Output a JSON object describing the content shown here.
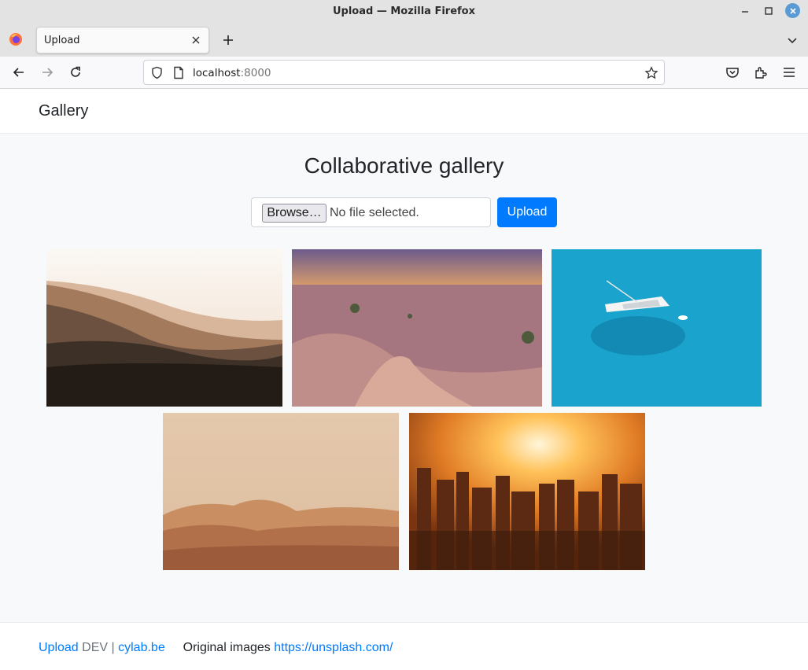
{
  "window": {
    "title": "Upload — Mozilla Firefox"
  },
  "browser": {
    "tab_label": "Upload",
    "url_host": "localhost",
    "url_port": ":8000"
  },
  "navbar": {
    "brand": "Gallery"
  },
  "main": {
    "heading": "Collaborative gallery",
    "file_input": {
      "button_label": "Browse…",
      "status": "No file selected."
    },
    "upload_button": "Upload",
    "images": [
      {
        "subject": "misty forested hills at sunrise"
      },
      {
        "subject": "desert dunes at dusk"
      },
      {
        "subject": "sailboat on turquoise sea, aerial view"
      },
      {
        "subject": "sand dunes under hazy sky"
      },
      {
        "subject": "city skyline at sunset"
      }
    ]
  },
  "footer": {
    "upload_link": "Upload",
    "env": "DEV",
    "sep": "|",
    "site_link": "cylab.be",
    "credit_text": "Original images",
    "credit_link": "https://unsplash.com/"
  },
  "colors": {
    "primary": "#007bff",
    "page_bg": "#f8f9fa",
    "browser_chrome": "#e3e3e3"
  }
}
